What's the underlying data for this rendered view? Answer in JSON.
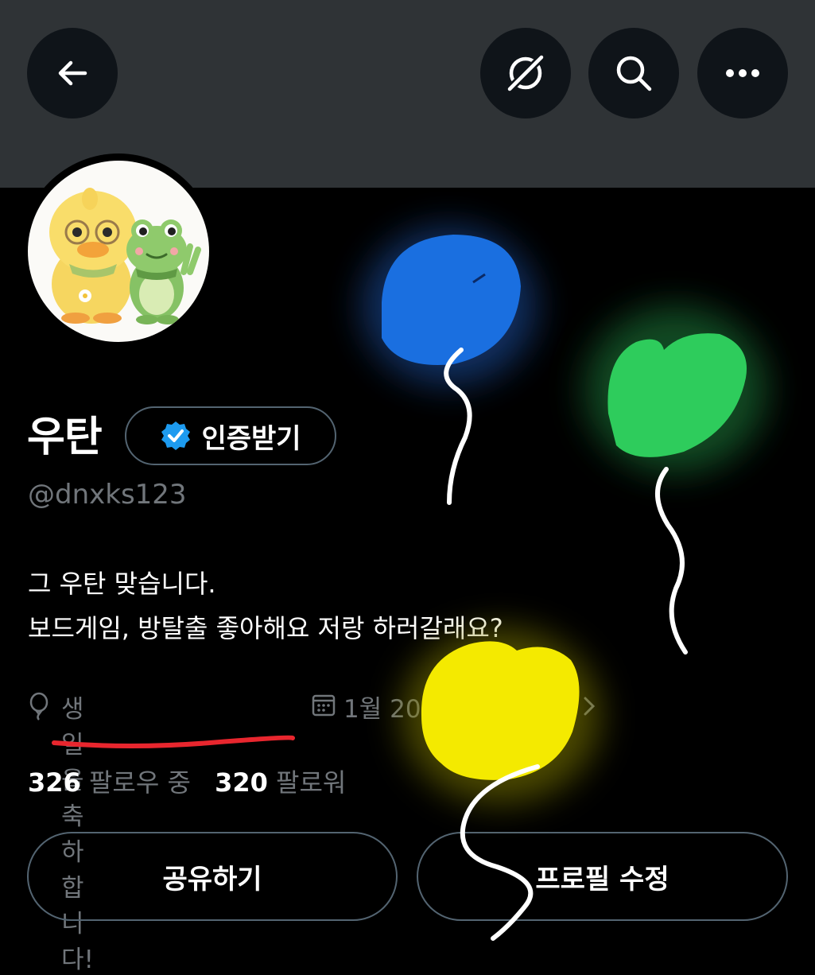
{
  "header": {
    "back_icon": "arrow-left-icon",
    "grok_icon": "grok-icon",
    "search_icon": "search-icon",
    "more_icon": "more-icon"
  },
  "profile": {
    "display_name": "우탄",
    "verify_label": "인증받기",
    "handle": "@dnxks123",
    "bio_lines": [
      "그 우탄 맞습니다.",
      "보드게임, 방탈출 좋아해요 저랑 하러갈래요?"
    ],
    "birthday": "생일을 축하합니다!",
    "joined_partial": "1월 20",
    "following_count": "326",
    "following_label": "팔로우 중",
    "followers_count": "320",
    "followers_label": "팔로워"
  },
  "actions": {
    "share_label": "공유하기",
    "edit_label": "프로필 수정"
  },
  "colors": {
    "header_bg": "#2f3336",
    "verified_blue": "#1d9bf0",
    "balloon_blue": "#1a6fe0",
    "balloon_green": "#2ecc5c",
    "balloon_yellow": "#f4ea00",
    "underline_red": "#e8262e"
  }
}
